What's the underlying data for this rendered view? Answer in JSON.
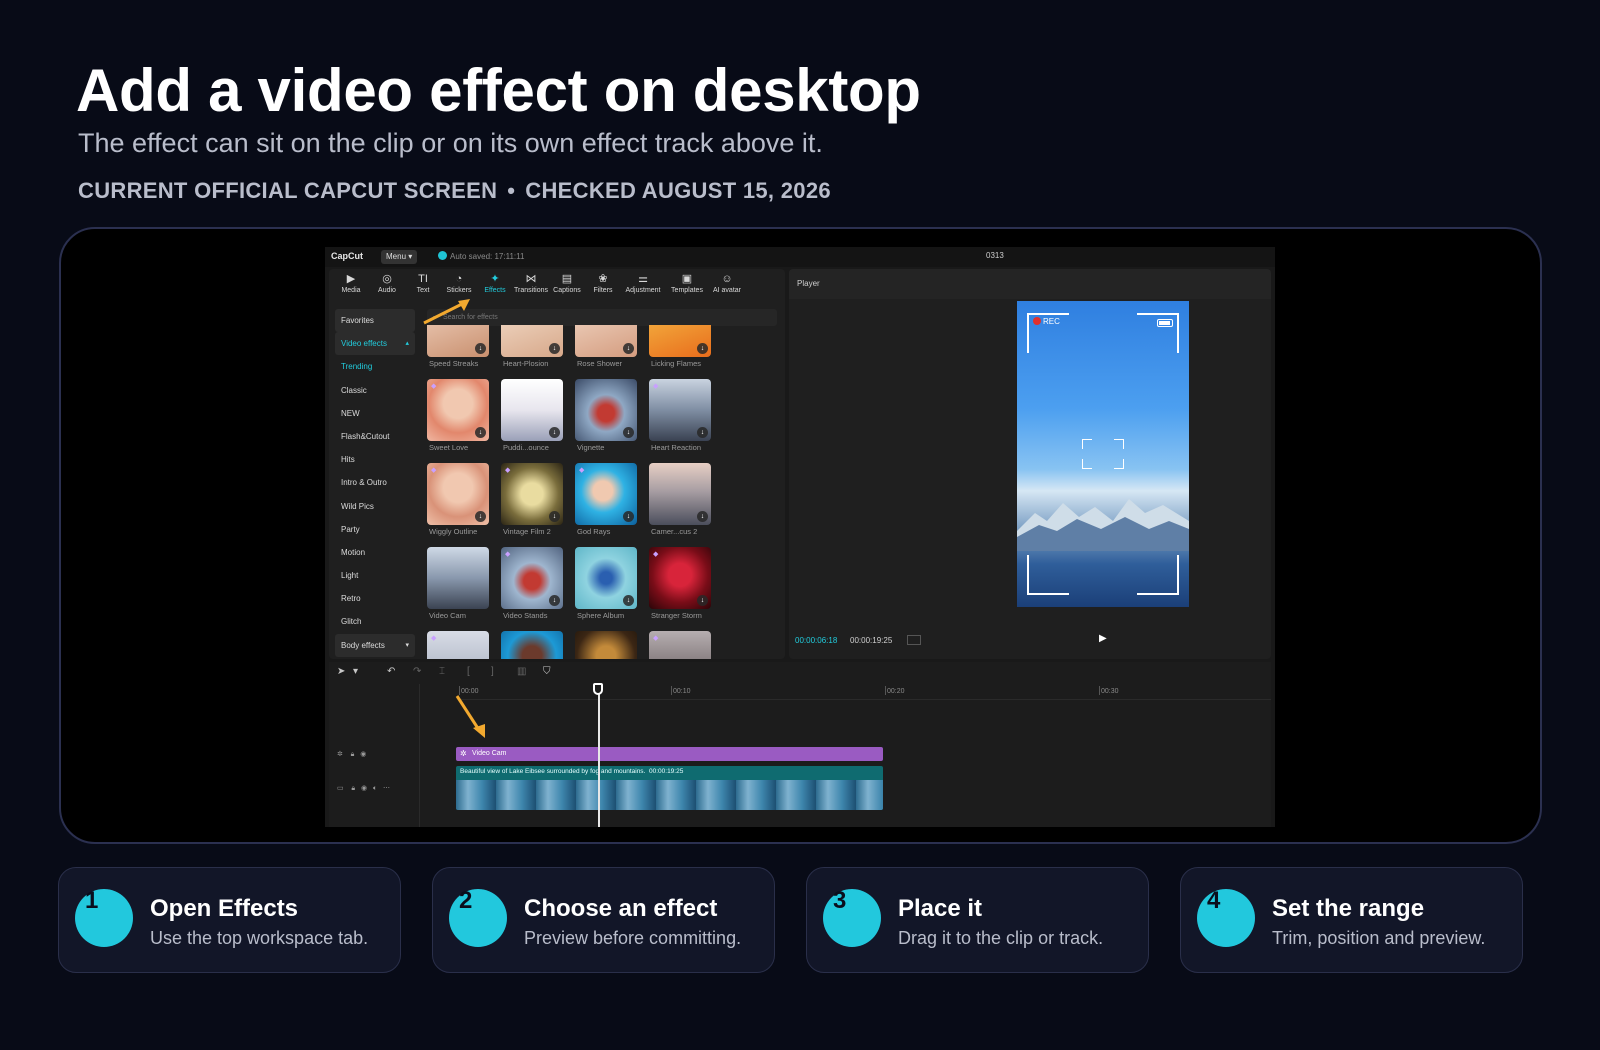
{
  "header": {
    "title": "Add a video effect on desktop",
    "subtitle": "The effect can sit on the clip or on its own effect track above it.",
    "meta_left": "CURRENT OFFICIAL CAPCUT SCREEN",
    "meta_separator": "•",
    "meta_right": "CHECKED AUGUST 15, 2026"
  },
  "app": {
    "logo": "CapCut",
    "menu_label": "Menu",
    "autosave": "Auto saved: 17:11:11",
    "project_name": "0313",
    "toolbar": [
      {
        "label": "Media",
        "icon": "media-icon"
      },
      {
        "label": "Audio",
        "icon": "audio-icon"
      },
      {
        "label": "Text",
        "icon": "text-icon"
      },
      {
        "label": "Stickers",
        "icon": "stickers-icon"
      },
      {
        "label": "Effects",
        "icon": "effects-icon"
      },
      {
        "label": "Transitions",
        "icon": "transitions-icon"
      },
      {
        "label": "Captions",
        "icon": "captions-icon"
      },
      {
        "label": "Filters",
        "icon": "filters-icon"
      },
      {
        "label": "Adjustment",
        "icon": "adjustment-icon"
      },
      {
        "label": "Templates",
        "icon": "templates-icon"
      },
      {
        "label": "AI avatar",
        "icon": "ai-avatar-icon"
      }
    ],
    "active_tab": "Effects",
    "categories": {
      "favorites": "Favorites",
      "video_effects": "Video effects",
      "items": [
        "Trending",
        "Classic",
        "NEW",
        "Flash&Cutout",
        "Hits",
        "Intro & Outro",
        "Wild Pics",
        "Party",
        "Motion",
        "Light",
        "Retro",
        "Glitch"
      ],
      "body_effects": "Body effects"
    },
    "search_placeholder": "Search for effects",
    "effects": [
      "Speed Streaks",
      "Heart-Plosion",
      "Rose Shower",
      "Licking Flames",
      "Sweet Love",
      "Puddi...ounce",
      "Vignette",
      "Heart Reaction",
      "Wiggly Outline",
      "Vintage Film 2",
      "God Rays",
      "Camer...cus 2",
      "Video Cam",
      "Video Stands",
      "Sphere Album",
      "Stranger Storm"
    ],
    "player": {
      "label": "Player",
      "rec": "REC",
      "time_current": "00:00:06:18",
      "time_total": "00:00:19:25"
    },
    "timeline": {
      "ticks": [
        "00:00",
        "00:10",
        "00:20",
        "00:30"
      ],
      "effect_clip": "Video Cam",
      "video_caption": "Beautiful view of Lake Eibsee surrounded by fog and mountains.",
      "video_duration": "00:00:19:25"
    },
    "colors": {
      "accent": "#22ccdd",
      "effect_track": "#9a5bc2",
      "video_track": "#0f6b70",
      "arrow": "#f2a92f"
    }
  },
  "steps": [
    {
      "num": "1",
      "title": "Open Effects",
      "desc": "Use the top workspace tab."
    },
    {
      "num": "2",
      "title": "Choose an effect",
      "desc": "Preview before committing."
    },
    {
      "num": "3",
      "title": "Place it",
      "desc": "Drag it to the clip or track."
    },
    {
      "num": "4",
      "title": "Set the range",
      "desc": "Trim, position and preview."
    }
  ]
}
